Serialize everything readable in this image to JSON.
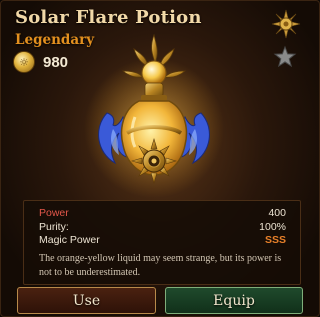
{
  "item": {
    "name": "Solar Flare Potion",
    "rarity": "Legendary",
    "coin_value": "980"
  },
  "stats": [
    {
      "label": "Power",
      "value": "400"
    },
    {
      "label": "Purity:",
      "value": "100%"
    },
    {
      "label": "Magic Power",
      "value": "SSS"
    }
  ],
  "description": "The orange-yellow liquid may seem strange, but its power is not to be underestimated.",
  "buttons": {
    "use": "Use",
    "equip": "Equip"
  },
  "icons": {
    "coin": "gold-coin-icon",
    "sun_badge": "sun-emblem-icon",
    "favorite": "star-icon",
    "potion": "solar-flare-potion-icon"
  },
  "colors": {
    "rarity": "#e3901f",
    "title": "#f2d9a8",
    "stat_highlight": "#e8802a",
    "use_button": "#3a180b",
    "equip_button": "#1a3d24"
  }
}
